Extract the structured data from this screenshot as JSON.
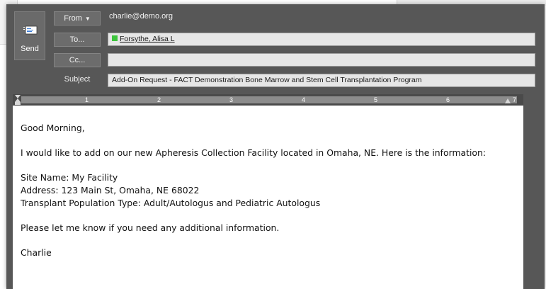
{
  "toolbar": {
    "send_label": "Send",
    "from_label": "From",
    "to_label": "To...",
    "cc_label": "Cc...",
    "subject_label": "Subject"
  },
  "message": {
    "from_address": "charlie@demo.org",
    "to_recipients": [
      "Forsythe, Alisa L"
    ],
    "cc_value": "",
    "subject": "Add-On Request - FACT Demonstration Bone Marrow and Stem Cell Transplantation Program"
  },
  "ruler": {
    "numbers": [
      "1",
      "2",
      "3",
      "4",
      "5",
      "6",
      "7"
    ]
  },
  "body": {
    "lines": [
      "Good Morning,",
      "I would like to add on our new Apheresis Collection Facility located in Omaha, NE.  Here is the information:",
      "Site Name: My Facility",
      "Address: 123 Main St, Omaha, NE 68022",
      "Transplant Population Type: Adult/Autologus and Pediatric Autologus",
      "Please let me know if you need any additional information.",
      "Charlie"
    ]
  },
  "colors": {
    "window_bg": "#575757",
    "field_bg": "#e6e6e6",
    "presence_green": "#3cc43c"
  },
  "icons": {
    "send": "envelope-icon",
    "from_dropdown": "caret-down-icon",
    "presence": "presence-status-icon"
  }
}
